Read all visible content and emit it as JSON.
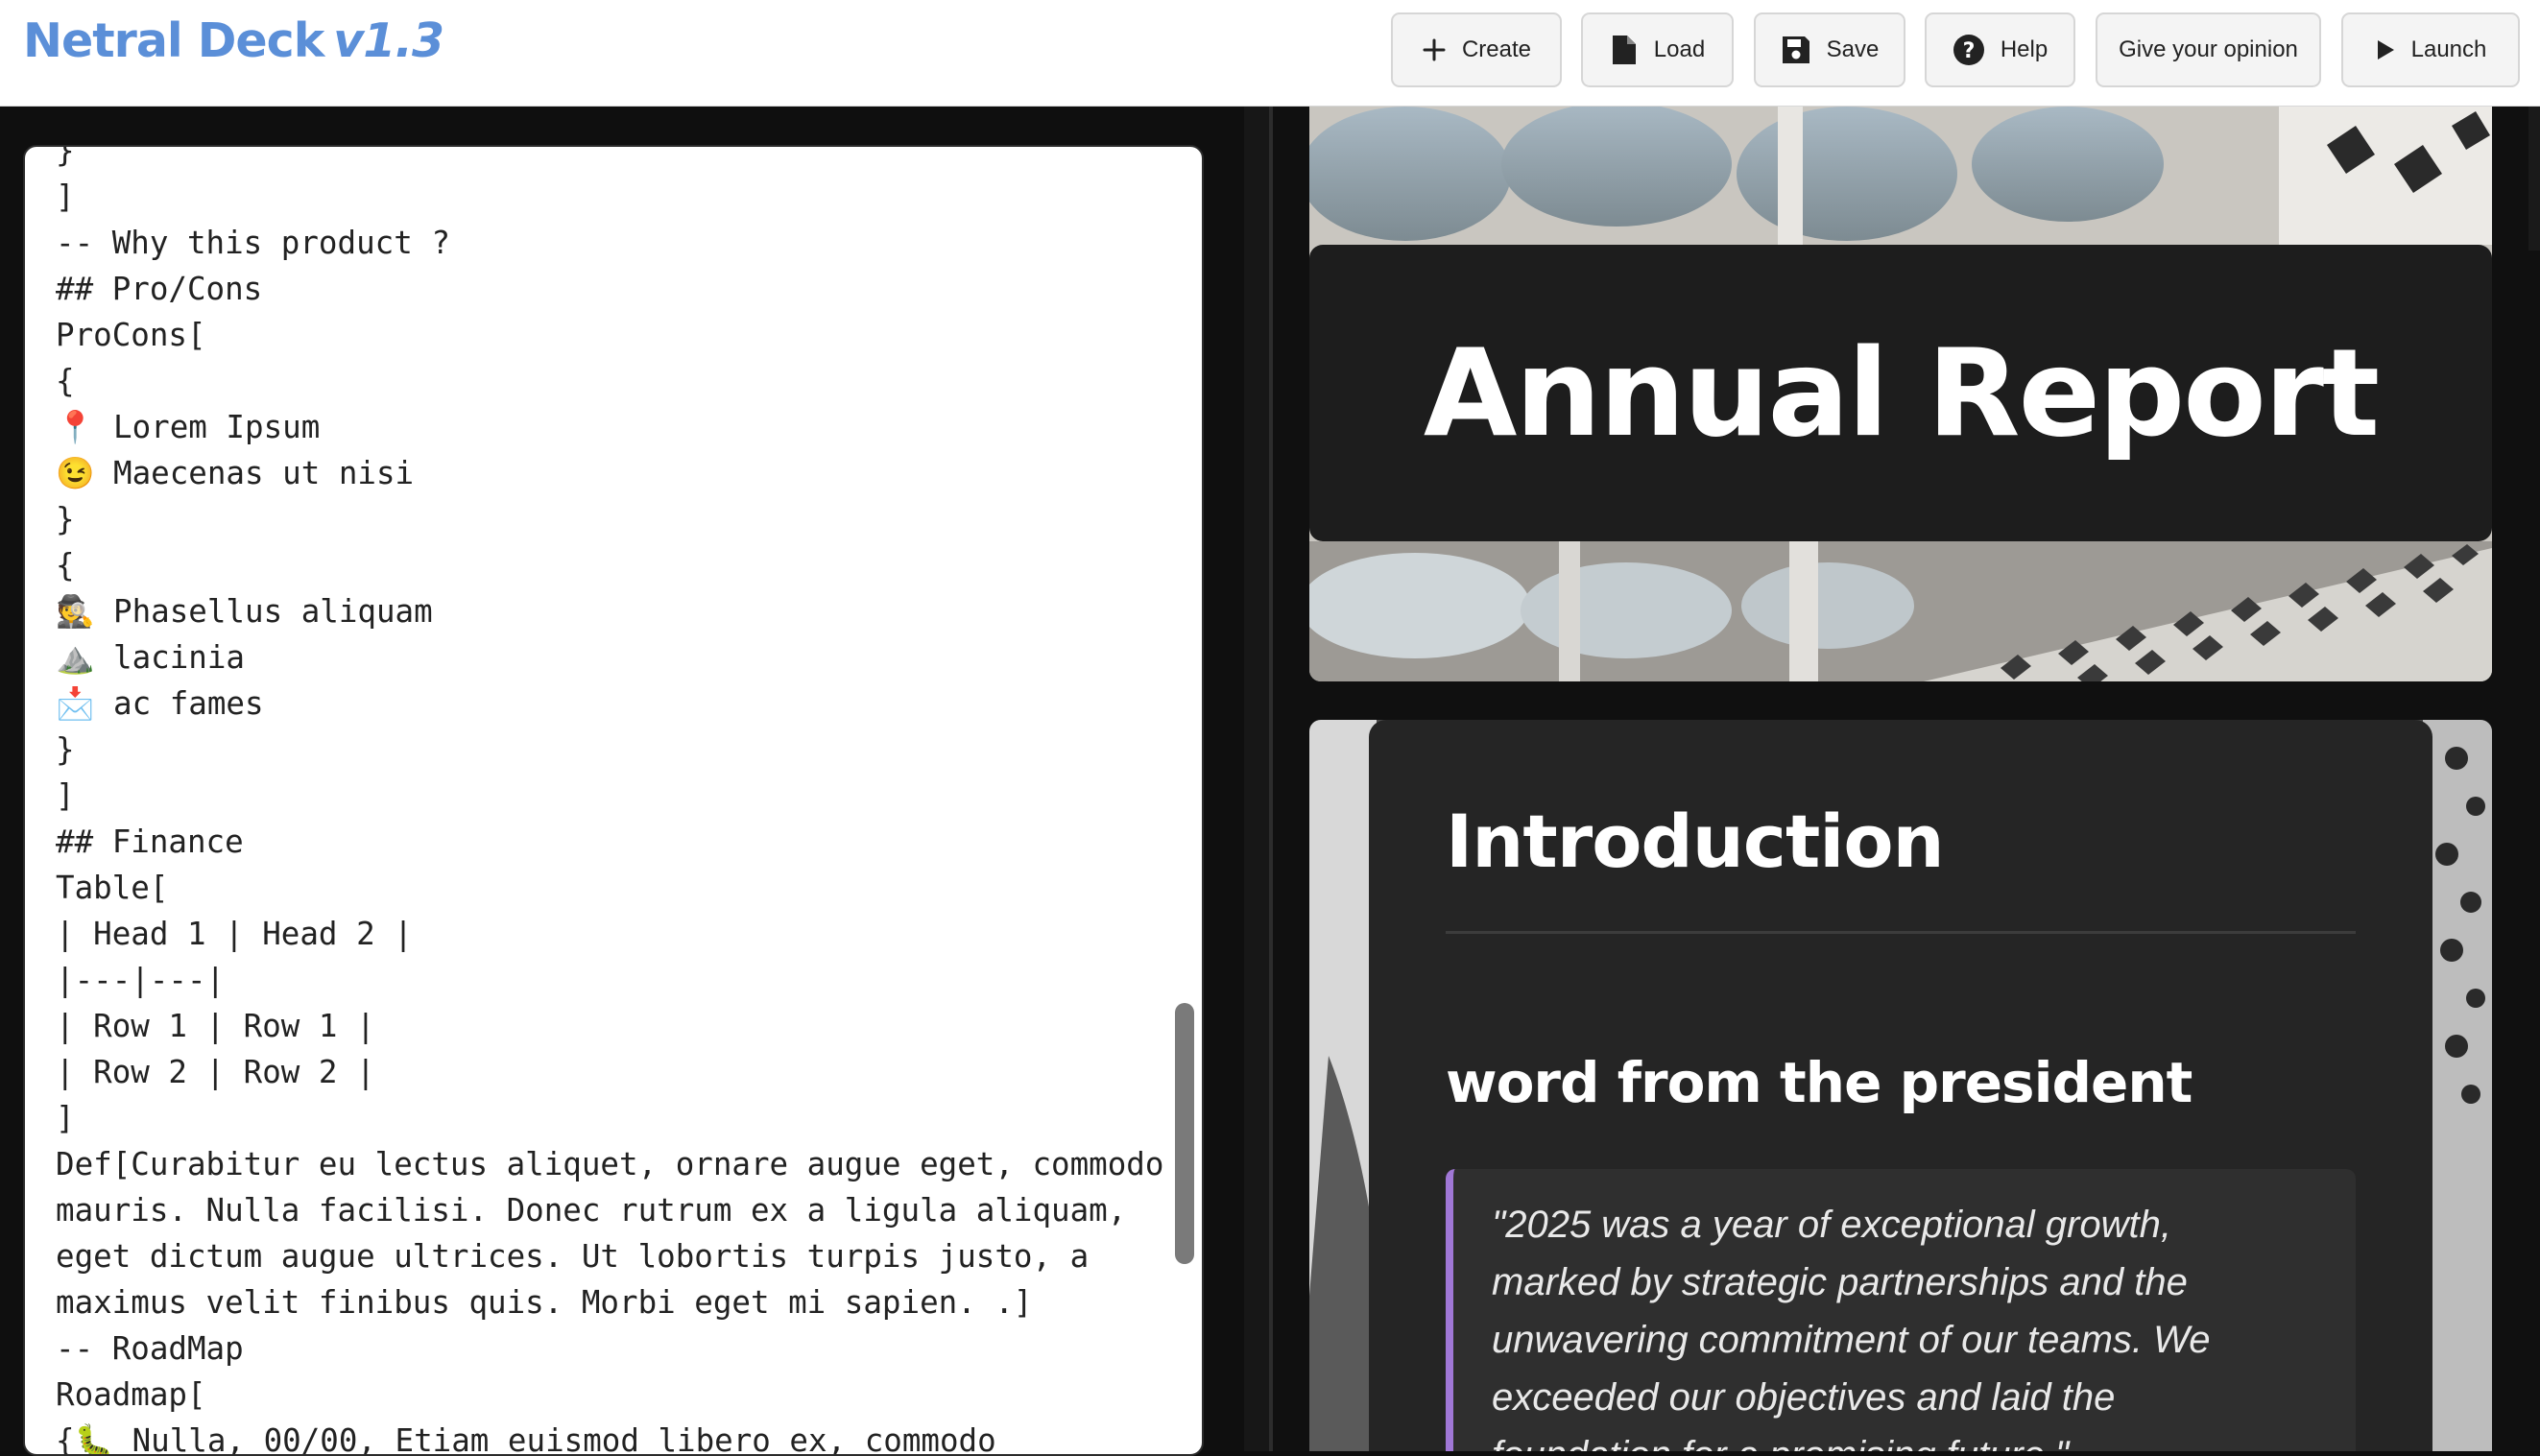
{
  "app": {
    "name": "Netral Deck",
    "version": "v1.3"
  },
  "toolbar": {
    "buttons": [
      {
        "label": "Create",
        "icon": "plus-icon"
      },
      {
        "label": "Load",
        "icon": "file-icon"
      },
      {
        "label": "Save",
        "icon": "floppy-icon"
      },
      {
        "label": "Help",
        "icon": "question-icon"
      },
      {
        "label": "Give your opinion",
        "icon": ""
      },
      {
        "label": "Launch",
        "icon": "play-icon"
      }
    ]
  },
  "editor": {
    "lines": [
      "}",
      "]",
      "-- Why this product ?",
      "## Pro/Cons",
      "ProCons[",
      "{",
      "📍 Lorem Ipsum",
      "😉 Maecenas ut nisi",
      "}",
      "{",
      "🕵️ Phasellus aliquam",
      "⛰️ lacinia",
      "📩 ac fames",
      "}",
      "]",
      "## Finance",
      "Table[",
      "| Head 1 | Head 2 |",
      "|---|---|",
      "| Row 1 | Row 1 |",
      "| Row 2 | Row 2 |",
      "]",
      "Def[Curabitur eu lectus aliquet, ornare augue eget, commodo",
      "mauris. Nulla facilisi. Donec rutrum ex a ligula aliquam,",
      "eget dictum augue ultrices. Ut lobortis turpis justo, a",
      "maximus velit finibus quis. Morbi eget mi sapien. .]",
      "-- RoadMap",
      "Roadmap[",
      "{🐛 Nulla, 00/00, Etiam euismod libero ex, commodo"
    ]
  },
  "preview": {
    "title_slide": {
      "title": "Annual Report"
    },
    "intro_slide": {
      "heading": "Introduction",
      "subheading": "word from the president",
      "quote_lines": [
        "\"2025 was a year of exceptional growth,",
        "marked by strategic partnerships and the",
        "unwavering commitment of our teams. We",
        "exceeded our objectives and laid the",
        "foundation for a promising future.\""
      ]
    }
  },
  "colors": {
    "brand": "#5b8fd8",
    "quote_accent": "#a077d6"
  }
}
